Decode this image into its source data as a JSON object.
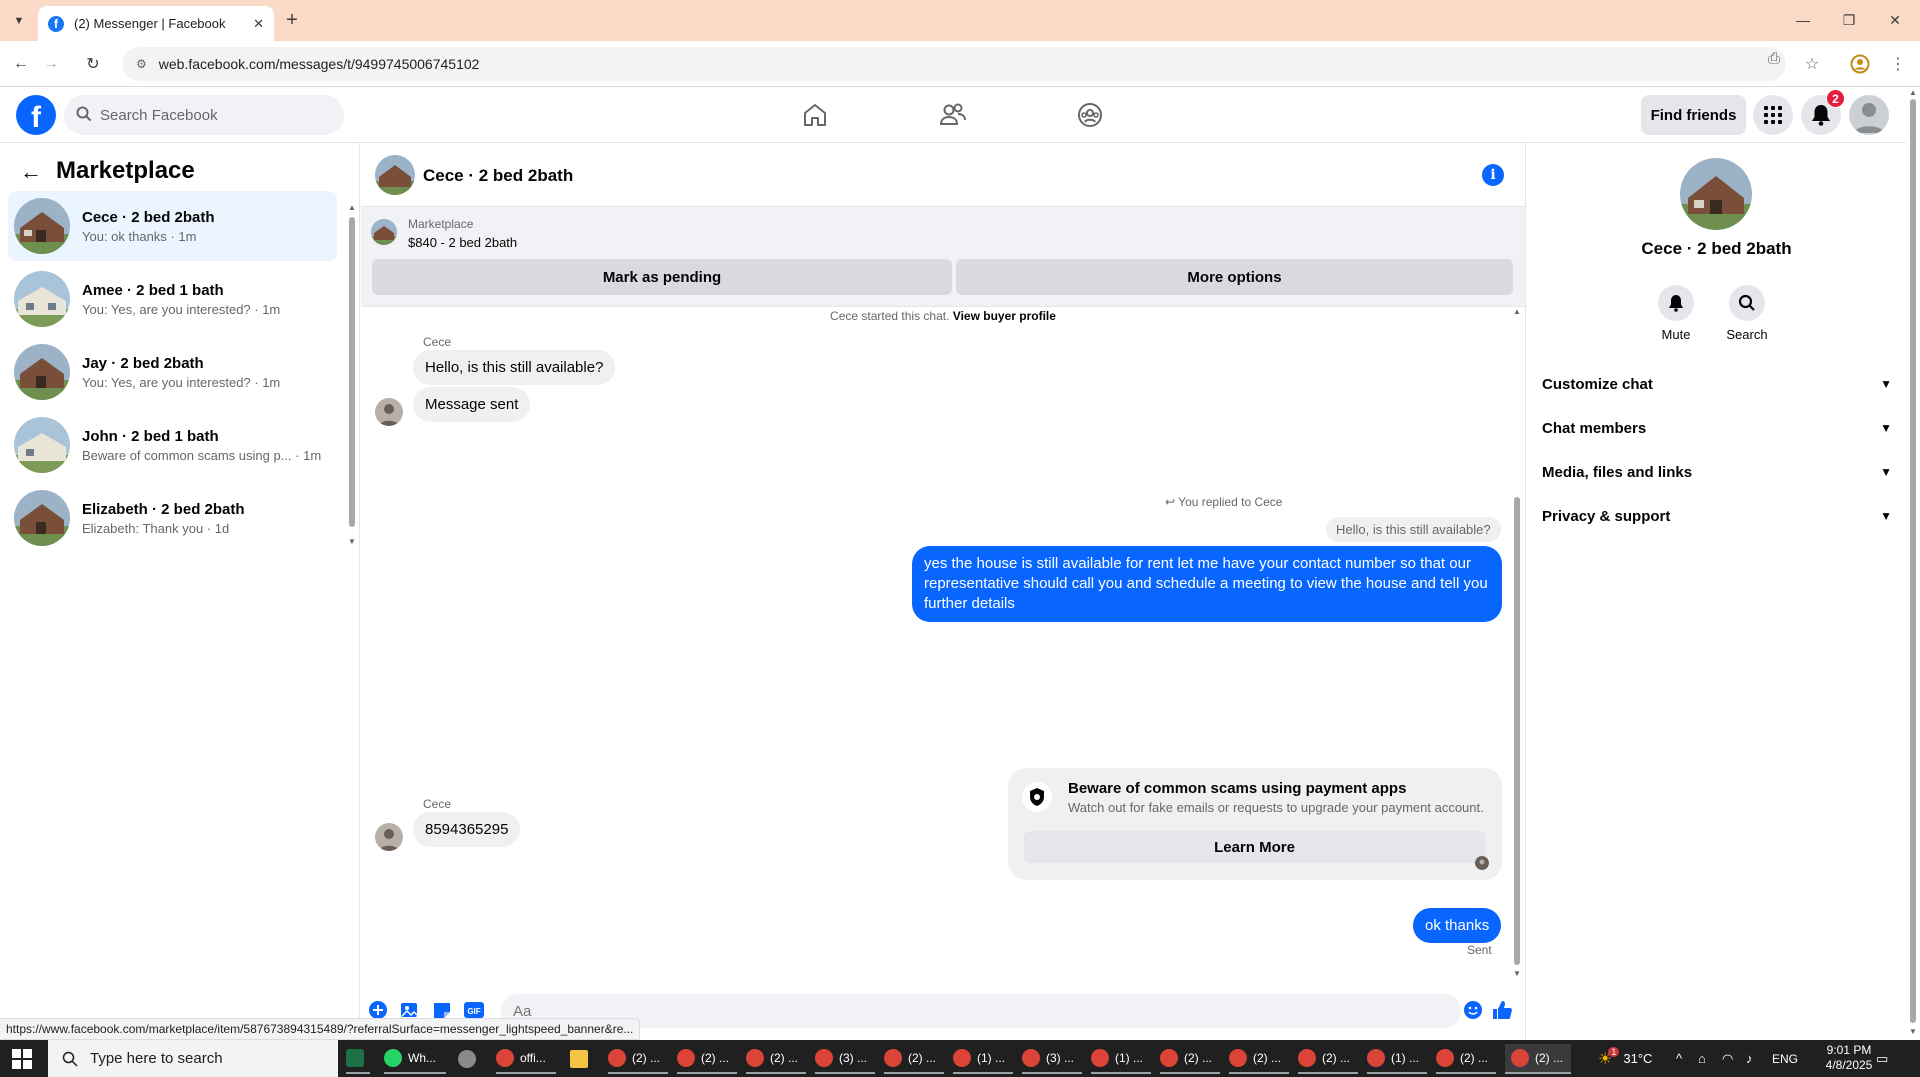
{
  "browser": {
    "tab_title": "(2) Messenger | Facebook",
    "url": "web.facebook.com/messages/t/9499745006745102"
  },
  "header": {
    "search_placeholder": "Search Facebook",
    "find_friends_label": "Find friends",
    "notification_count": "2"
  },
  "sidebar": {
    "title": "Marketplace",
    "conversations": [
      {
        "name": "Cece · 2 bed 2bath",
        "preview": "You: ok thanks · 1m",
        "active": true
      },
      {
        "name": "Amee · 2 bed 1 bath",
        "preview": "You: Yes, are you interested? · 1m"
      },
      {
        "name": "Jay · 2 bed 2bath",
        "preview": "You: Yes, are you interested? · 1m"
      },
      {
        "name": "John · 2 bed 1 bath",
        "preview": "Beware of common scams using p... · 1m"
      },
      {
        "name": "Elizabeth · 2 bed 2bath",
        "preview": "Elizabeth: Thank you · 1d"
      }
    ]
  },
  "chat": {
    "title": "Cece · 2 bed 2bath",
    "marketplace_label": "Marketplace",
    "listing": "$840 - 2 bed 2bath",
    "mark_pending_label": "Mark as pending",
    "more_options_label": "More options",
    "system_prefix": "Cece started this chat.",
    "system_link": "View buyer profile",
    "messages": {
      "sender_1": "Cece",
      "msg_1": "Hello, is this still available?",
      "msg_2": "Message sent",
      "reply_note": "You replied to Cece",
      "reply_quote": "Hello, is this still available?",
      "reply_body": "yes the house is still available for rent let me have your contact number so that our representative should call you and schedule a meeting to view the house and tell you further details",
      "sender_2": "Cece",
      "msg_3": "8594365295",
      "msg_4": "ok thanks",
      "status": "Sent"
    },
    "scam_card": {
      "title": "Beware of common scams using payment apps",
      "subtitle": "Watch out for fake emails or requests to upgrade your payment account.",
      "button": "Learn More"
    },
    "composer_placeholder": "Aa"
  },
  "right_panel": {
    "name": "Cece · 2 bed 2bath",
    "mute_label": "Mute",
    "search_label": "Search",
    "sections": [
      "Customize chat",
      "Chat members",
      "Media, files and links",
      "Privacy & support"
    ]
  },
  "status_bar_url": "https://www.facebook.com/marketplace/item/587673894315489/?referralSurface=messenger_lightspeed_banner&re...",
  "taskbar": {
    "search_placeholder": "Type here to search",
    "apps": [
      "Wh...",
      "offi...",
      "(2) ...",
      "(2) ...",
      "(2) ...",
      "(3) ...",
      "(2) ...",
      "(1) ...",
      "(3) ...",
      "(1) ...",
      "(2) ...",
      "(2) ...",
      "(2) ...",
      "(1) ...",
      "(2) ...",
      "(2) ..."
    ],
    "weather_badge": "1",
    "temperature": "31°C",
    "language": "ENG",
    "time": "9:01 PM",
    "date": "4/8/2025"
  },
  "colors": {
    "facebook_blue": "#0866ff",
    "tab_strip": "#fbd9c7",
    "active_conversation": "#ebf5ff",
    "notification_red": "#e41e3f"
  }
}
